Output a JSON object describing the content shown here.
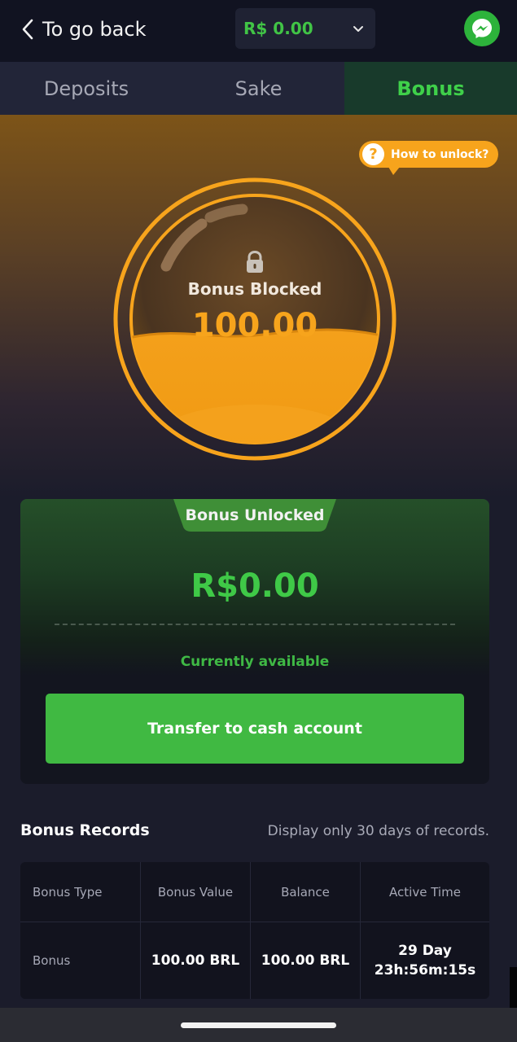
{
  "header": {
    "back_label": "To go back",
    "balance": "R$ 0.00",
    "back_icon": "chevron-left-icon",
    "dropdown_icon": "chevron-down-icon",
    "messenger_icon": "messenger-icon"
  },
  "tabs": [
    {
      "label": "Deposits",
      "active": false
    },
    {
      "label": "Sake",
      "active": false
    },
    {
      "label": "Bonus",
      "active": true
    }
  ],
  "hero": {
    "how_to_unlock": "How to unlock?",
    "question_glyph": "?",
    "blocked_label": "Bonus Blocked",
    "blocked_amount": "100.00",
    "lock_icon": "lock-icon"
  },
  "unlocked": {
    "badge": "Bonus Unlocked",
    "amount": "R$0.00",
    "available_label": "Currently available",
    "transfer_button": "Transfer to cash account"
  },
  "records": {
    "title": "Bonus Records",
    "note": "Display only 30 days of records.",
    "columns": [
      "Bonus Type",
      "Bonus Value",
      "Balance",
      "Active Time"
    ],
    "rows": [
      {
        "type": "Bonus",
        "value": "100.00 BRL",
        "balance": "100.00 BRL",
        "time_days": "29 Day",
        "time_clock": "23h:56m:15s"
      }
    ]
  },
  "colors": {
    "accent_green": "#40b942",
    "accent_orange": "#f7a41c",
    "background": "#1b1c2b"
  }
}
